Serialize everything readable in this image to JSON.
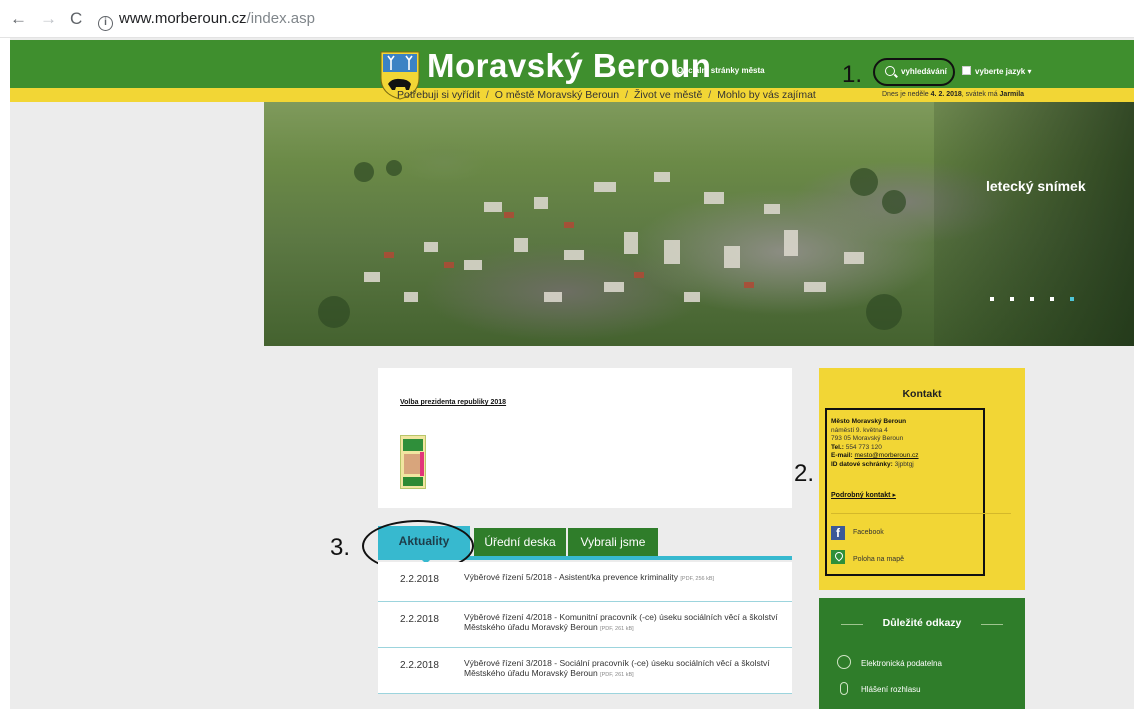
{
  "browser": {
    "back": "←",
    "forward": "→",
    "reload": "C",
    "info": "i",
    "url_host": "www.morberoun.cz",
    "url_path": "/index.asp"
  },
  "header": {
    "title": "Moravský Beroun",
    "subtitle": "Oficiální stránky města",
    "search_label": "vyhledávání",
    "lang_label": "vyberte jazyk ▾",
    "annotation_1": "1.",
    "date_prefix": "Dnes je neděle ",
    "date_value": "4. 2. 2018",
    "date_mid": ", svátek má ",
    "name_day": "Jarmila",
    "nav": [
      "Potřebuji si vyřídit",
      "O městě Moravský Beroun",
      "Život ve městě",
      "Mohlo by vás zajímat"
    ],
    "nav_separator": "/"
  },
  "hero": {
    "caption": "letecký snímek",
    "dots": 5,
    "active_dot": 5
  },
  "card": {
    "link": "Volba prezidenta republiky 2018"
  },
  "tabs": {
    "annotation_3": "3.",
    "items": [
      "Aktuality",
      "Úřední deska",
      "Vybrali jsme"
    ]
  },
  "news": [
    {
      "date": "2.2.2018",
      "text": "Výběrové řízení 5/2018 - Asistent/ka prevence kriminality",
      "pdf": "[PDF, 256 kB]"
    },
    {
      "date": "2.2.2018",
      "text": "Výběrové řízení 4/2018 - Komunitní pracovník (-ce) úseku sociálních věcí a školství Městského úřadu Moravský Beroun",
      "pdf": "[PDF, 261 kB]"
    },
    {
      "date": "2.2.2018",
      "text": "Výběrové řízení 3/2018 - Sociální pracovník (-ce) úseku sociálních věcí a školství Městského úřadu Moravský Beroun",
      "pdf": "[PDF, 261 kB]"
    }
  ],
  "kontakt": {
    "title": "Kontakt",
    "annotation_2": "2.",
    "org": "Město Moravský Beroun",
    "street": "náměstí 9. května 4",
    "city": "793 05 Moravský Beroun",
    "tel_label": "Tel.:",
    "tel": "554 773 120",
    "email_label": "E-mail:",
    "email": "mesto@morberoun.cz",
    "ds_label": "ID datové schránky:",
    "ds": "3jpbtgj",
    "detail_link": "Podrobný kontakt",
    "detail_arrow": "▸",
    "facebook": "Facebook",
    "facebook_icon": "f",
    "map": "Poloha na mapě"
  },
  "odkazy": {
    "title": "Důležité odkazy",
    "items": [
      "Elektronická podatelna",
      "Hlášení rozhlasu"
    ]
  },
  "colors": {
    "green": "#3f8f2e",
    "yellow": "#f2d635",
    "cyan": "#37b9cf",
    "dark_green": "#2f7d2a"
  }
}
